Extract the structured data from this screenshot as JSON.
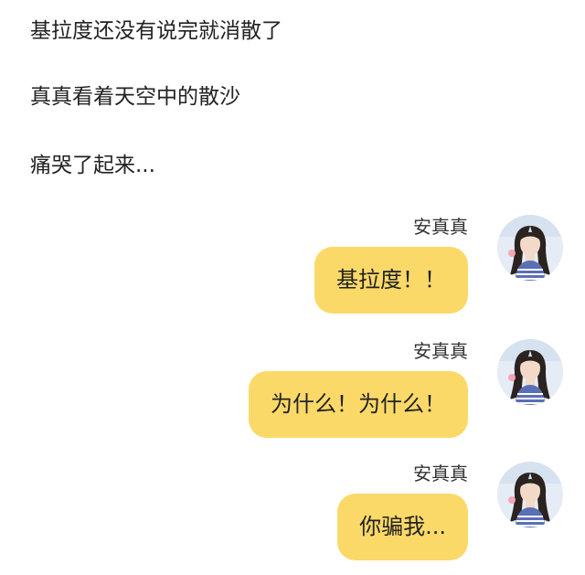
{
  "narration": [
    "基拉度还没有说完就消散了",
    "真真看着天空中的散沙",
    "痛哭了起来..."
  ],
  "messages": [
    {
      "sender": "安真真",
      "text": "基拉度！！",
      "avatar": "girl-avatar-icon"
    },
    {
      "sender": "安真真",
      "text": "为什么！为什么！",
      "avatar": "girl-avatar-icon"
    },
    {
      "sender": "安真真",
      "text": "你骗我...",
      "avatar": "girl-avatar-icon"
    }
  ],
  "colors": {
    "bubble": "#fbd968",
    "text": "#222222",
    "background": "#ffffff"
  }
}
